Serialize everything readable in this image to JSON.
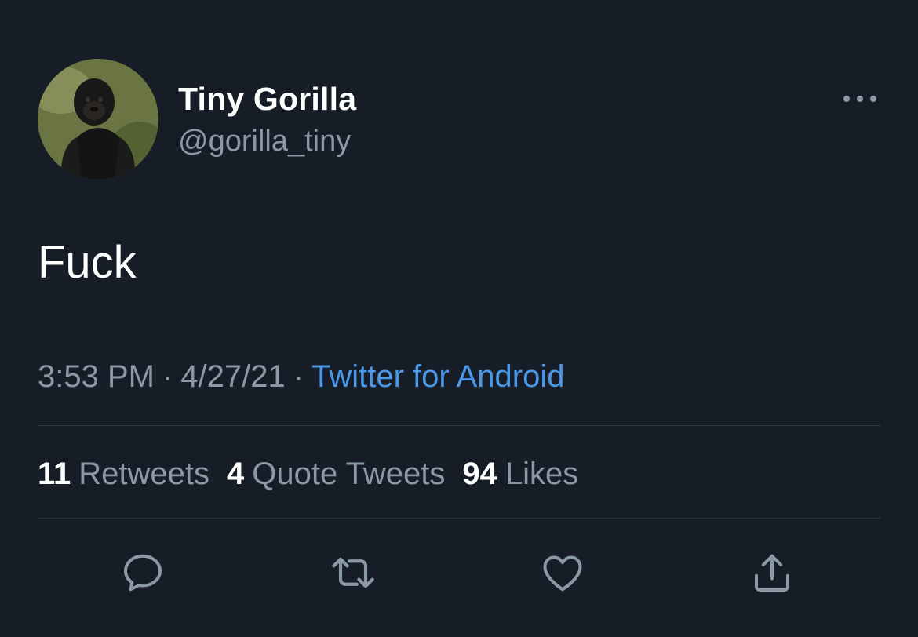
{
  "tweet": {
    "author": {
      "display_name": "Tiny Gorilla",
      "handle": "@gorilla_tiny",
      "avatar_icon": "gorilla-avatar"
    },
    "text": "Fuck",
    "time": "3:53 PM",
    "separator": "·",
    "date": "4/27/21",
    "source": "Twitter for Android",
    "stats": [
      {
        "count": "11",
        "label": "Retweets"
      },
      {
        "count": "4",
        "label": "Quote Tweets"
      },
      {
        "count": "94",
        "label": "Likes"
      }
    ],
    "actions": [
      "reply-icon",
      "retweet-icon",
      "like-icon",
      "share-icon"
    ]
  },
  "colors": {
    "background": "#161d27",
    "primary_text": "#ffffff",
    "secondary_text": "#8b98a5",
    "link": "#4a99e9",
    "divider": "#2f3a45"
  }
}
